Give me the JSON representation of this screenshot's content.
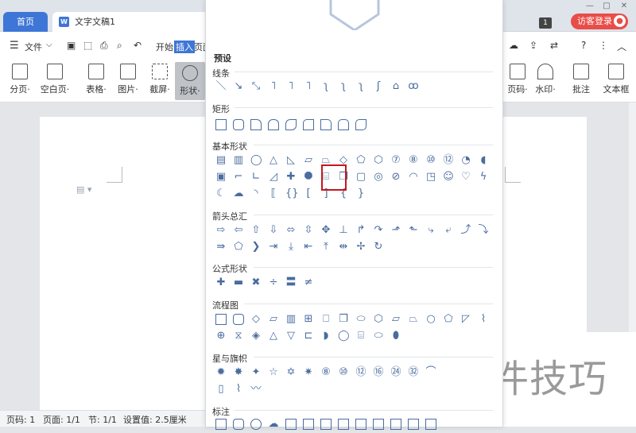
{
  "tabs": {
    "home": "首页",
    "doc": "文字文稿1"
  },
  "titlebar": {
    "badge": "1",
    "visitor": "访客登录"
  },
  "menu": {
    "file": "文件",
    "start": "开始",
    "insert": "插入",
    "page": "页面"
  },
  "ribbon_left": [
    {
      "label": "分页·",
      "icon": "page-break-icon"
    },
    {
      "label": "空白页·",
      "icon": "blank-page-icon"
    },
    {
      "label": "表格·",
      "icon": "table-icon"
    },
    {
      "label": "图片·",
      "icon": "picture-icon"
    },
    {
      "label": "截屏·",
      "icon": "screenshot-icon"
    },
    {
      "label": "形状·",
      "icon": "shape-icon"
    }
  ],
  "ribbon_right": [
    {
      "label": "页码·",
      "icon": "page-number-icon"
    },
    {
      "label": "水印·",
      "icon": "watermark-icon"
    },
    {
      "label": "批注",
      "icon": "comment-icon"
    },
    {
      "label": "文本框",
      "icon": "textbox-icon"
    }
  ],
  "panel": {
    "title": "预设",
    "sections": [
      {
        "name": "线条"
      },
      {
        "name": "矩形"
      },
      {
        "name": "基本形状"
      },
      {
        "name": "箭头总汇"
      },
      {
        "name": "公式形状"
      },
      {
        "name": "流程图"
      },
      {
        "name": "星与旗帜"
      },
      {
        "name": "标注"
      }
    ]
  },
  "statusbar": {
    "page_code": "页码: 1",
    "page": "页面: 1/1",
    "section": "节: 1/1",
    "setting": "设置值: 2.5厘米"
  },
  "watermark": "软件技巧",
  "colors": {
    "accent": "#3d76d6",
    "highlight": "#c8161d",
    "visitor": "#e94d48"
  }
}
